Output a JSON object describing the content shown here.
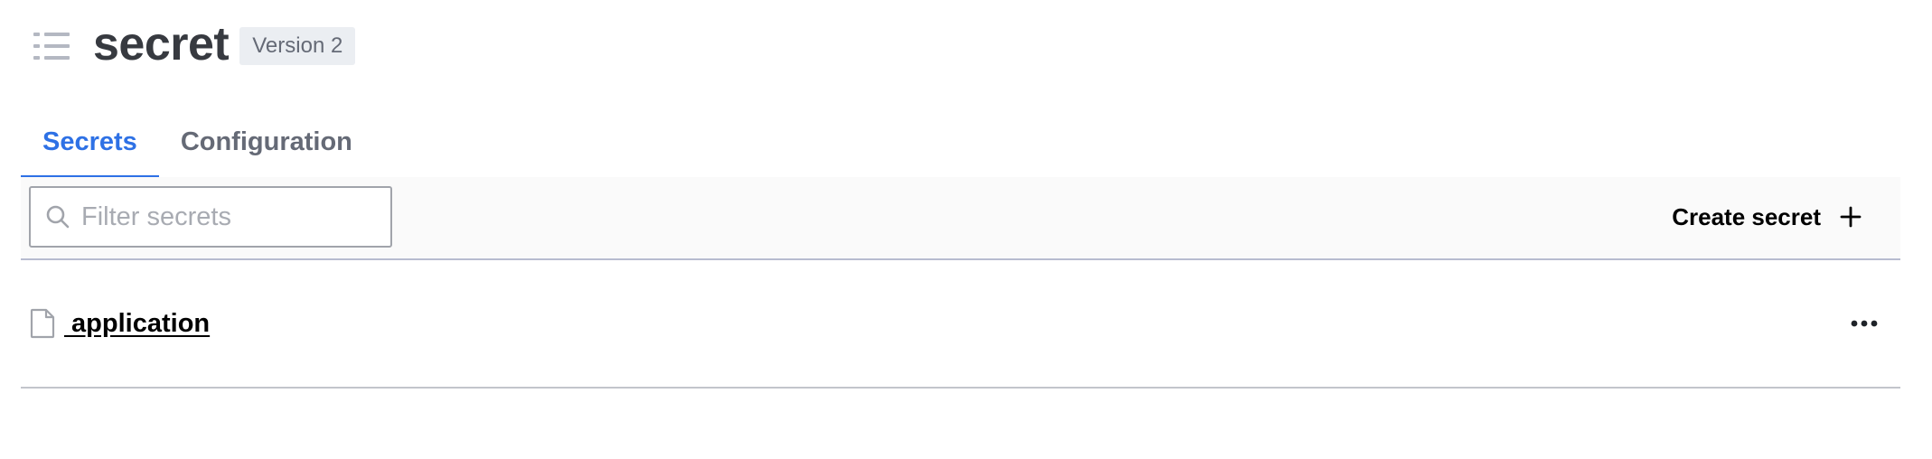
{
  "header": {
    "title": "secret",
    "version_badge": "Version 2",
    "menu_icon": "list-icon"
  },
  "tabs": [
    {
      "label": "Secrets",
      "active": true
    },
    {
      "label": "Configuration",
      "active": false
    }
  ],
  "toolbar": {
    "search": {
      "placeholder": "Filter secrets",
      "value": "",
      "icon": "search-icon"
    },
    "create_label": "Create secret",
    "create_icon": "plus-icon"
  },
  "list": {
    "items": [
      {
        "label": " application",
        "icon": "file-icon",
        "menu_icon": "more-icon"
      }
    ]
  },
  "colors": {
    "accent": "#2e71e5",
    "title": "#373a40",
    "muted": "#656a76",
    "badge_bg": "#ebeef2"
  }
}
